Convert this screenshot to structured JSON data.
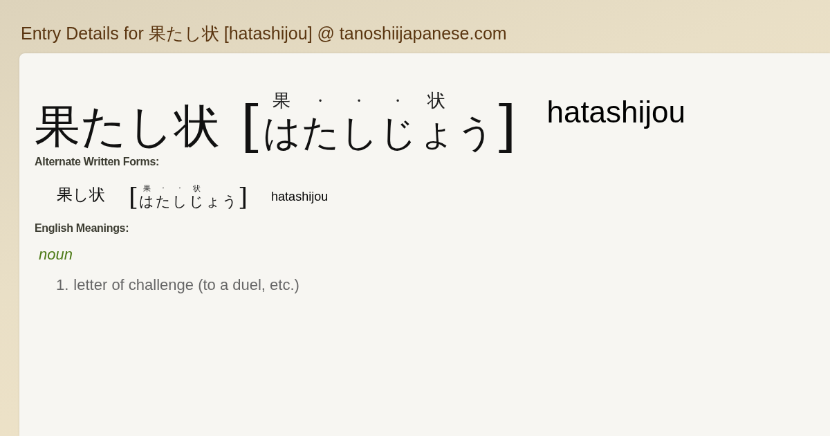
{
  "page_title": "Entry Details for 果たし状 [hatashijou] @ tanoshiijapanese.com",
  "entry": {
    "written": "果たし状",
    "open_bracket": "[",
    "close_bracket": "]",
    "reading": [
      {
        "kana": "は",
        "mark": "果"
      },
      {
        "kana": "た",
        "mark": "·"
      },
      {
        "kana": "し",
        "mark": "·"
      },
      {
        "kana": "じ",
        "mark": "·"
      },
      {
        "kana": "ょ",
        "mark": "状"
      },
      {
        "kana": "う"
      }
    ],
    "romaji": "hatashijou"
  },
  "alternate_heading": "Alternate Written Forms:",
  "alternates": [
    {
      "written": "果し状",
      "open_bracket": "[",
      "close_bracket": "]",
      "reading": [
        {
          "kana": "は",
          "mark": "果"
        },
        {
          "kana": "た",
          "mark": "·"
        },
        {
          "kana": "し",
          "mark": "·"
        },
        {
          "kana": "じ",
          "mark": "状"
        },
        {
          "kana": "ょ"
        },
        {
          "kana": "う"
        }
      ],
      "romaji": "hatashijou"
    }
  ],
  "meanings_heading": "English Meanings:",
  "meanings": [
    {
      "pos": "noun",
      "senses": [
        {
          "number": "1.",
          "text": "letter of challenge (to a duel, etc.)"
        }
      ]
    }
  ]
}
